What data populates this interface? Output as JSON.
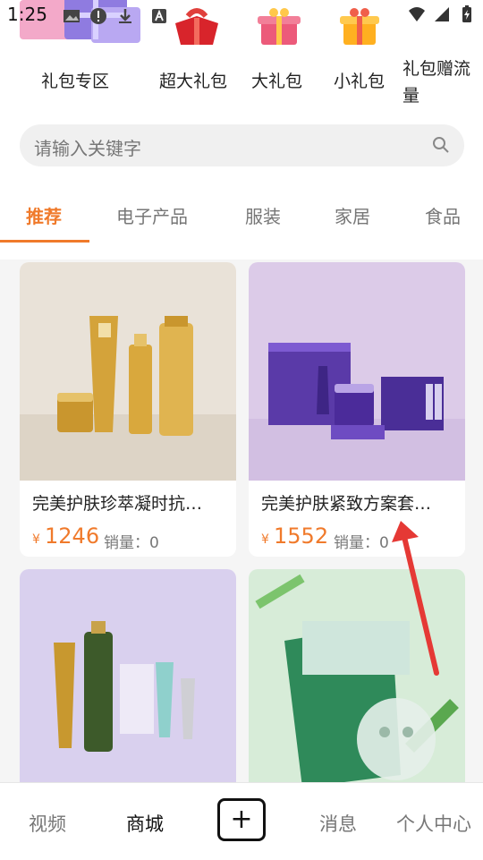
{
  "status_bar": {
    "time": "1:25"
  },
  "categories": [
    {
      "label": "礼包专区",
      "icon": "gift-pile-icon"
    },
    {
      "label": "超大礼包",
      "icon": "red-gift-icon"
    },
    {
      "label": "大礼包",
      "icon": "pink-gift-icon"
    },
    {
      "label": "小礼包",
      "icon": "yellow-gift-icon"
    },
    {
      "label_line1": "礼包赠流",
      "label_line2": "量",
      "icon": "none"
    }
  ],
  "search": {
    "placeholder": "请输入关键字",
    "icon": "search-icon"
  },
  "tabs": [
    {
      "label": "推荐",
      "active": true
    },
    {
      "label": "电子产品",
      "active": false
    },
    {
      "label": "服装",
      "active": false
    },
    {
      "label": "家居",
      "active": false
    },
    {
      "label": "食品",
      "active": false
    }
  ],
  "products": [
    {
      "title": "完美护肤珍萃凝时抗…",
      "currency": "¥",
      "price": "1246",
      "sales_label": "销量：",
      "sales": "0"
    },
    {
      "title": "完美护肤紧致方案套…",
      "currency": "¥",
      "price": "1552",
      "sales_label": "销量：",
      "sales": "0"
    },
    {
      "title": "",
      "currency": "",
      "price": "",
      "sales_label": "",
      "sales": ""
    },
    {
      "title": "",
      "currency": "",
      "price": "",
      "sales_label": "",
      "sales": ""
    }
  ],
  "bottom_nav": {
    "items": [
      {
        "label": "视频"
      },
      {
        "label": "商城",
        "active": true
      },
      {
        "label": "+"
      },
      {
        "label": "消息"
      },
      {
        "label": "个人中心"
      }
    ]
  },
  "colors": {
    "accent": "#f07a2b",
    "annotation_arrow": "#e53935"
  }
}
